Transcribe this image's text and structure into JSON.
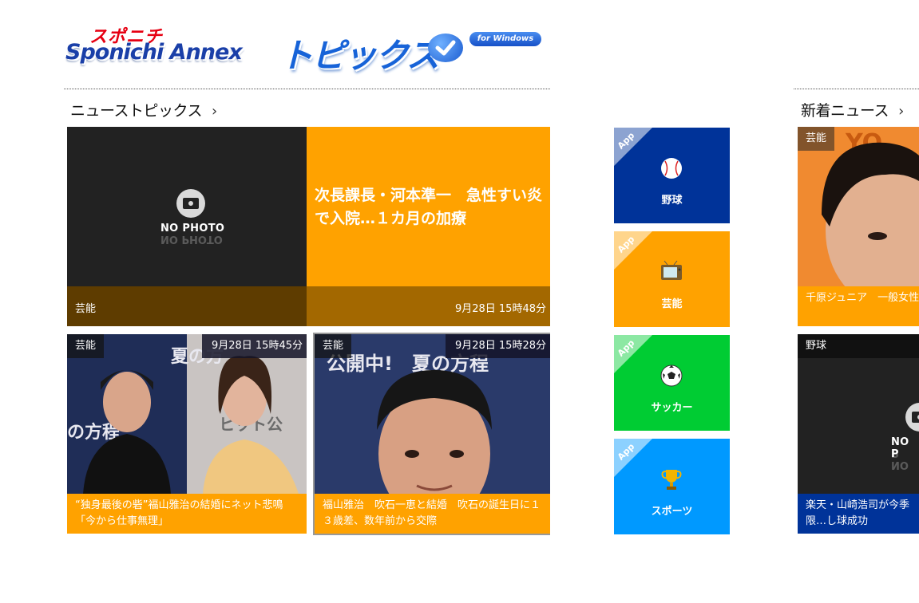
{
  "logo": {
    "small": "スポニチ",
    "main": "Sponichi Annex",
    "topics": "トピックス",
    "badge": "for Windows"
  },
  "sections": {
    "news_topics": "ニューストピックス",
    "latest_news": "新着ニュース"
  },
  "featured": {
    "nophoto": "NO PHOTO",
    "headline": "次長課長・河本準一　急性すい炎で入院…１カ月の加療",
    "category": "芸能",
    "date": "9月28日 15時48分"
  },
  "small_tiles": [
    {
      "category": "芸能",
      "date": "9月28日 15時45分",
      "caption": "“独身最後の砦”福山雅治の結婚にネット悲鳴「今から仕事無理」"
    },
    {
      "category": "芸能",
      "date": "9月28日 15時28分",
      "caption": "福山雅治　吹石一恵と結婚　吹石の誕生日に１３歳差、数年前から交際"
    }
  ],
  "apps": [
    {
      "corner": "App",
      "label": "野球",
      "icon": "baseball-icon",
      "color": "#003399"
    },
    {
      "corner": "App",
      "label": "芸能",
      "icon": "tv-icon",
      "color": "#ffa200"
    },
    {
      "corner": "App",
      "label": "サッカー",
      "icon": "soccer-ball-icon",
      "color": "#00cc33"
    },
    {
      "corner": "App",
      "label": "スポーツ",
      "icon": "trophy-icon",
      "color": "#0099ff"
    }
  ],
  "latest": [
    {
      "category": "芸能",
      "caption": "千原ジュニア　一般女性と…芯の強さにビビッと」"
    },
    {
      "category": "野球",
      "nophoto": "NO P",
      "caption": "楽天・山崎浩司が今季限…し球成功"
    }
  ]
}
